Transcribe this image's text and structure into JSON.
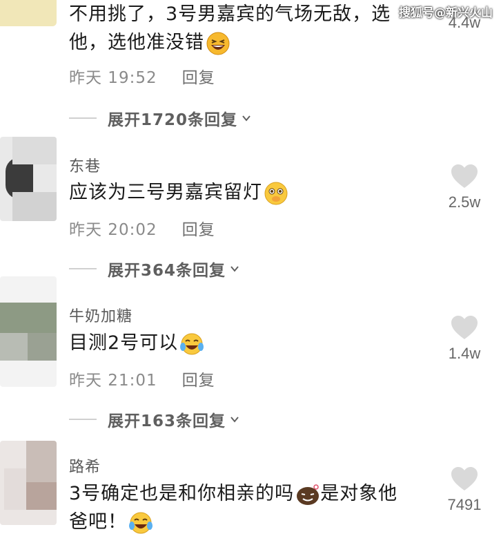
{
  "watermark": "搜狐号@新兴火山",
  "top_comment": {
    "line1": "不用挑了，3号男嘉宾的气场无敌，选",
    "line2": "他，选他准没错",
    "likes": "4.4w",
    "time": "昨天 19:52",
    "reply": "回复",
    "expand": "展开1720条回复"
  },
  "comments": [
    {
      "author": "东巷",
      "text": "应该为三号男嘉宾留灯",
      "likes": "2.5w",
      "time": "昨天 20:02",
      "reply": "回复",
      "expand": "展开364条回复"
    },
    {
      "author": "牛奶加糖",
      "text": "目测2号可以",
      "likes": "1.4w",
      "time": "昨天 21:01",
      "reply": "回复",
      "expand": "展开163条回复"
    },
    {
      "author": "路希",
      "text_line1_a": "3号确定也是和你相亲的吗",
      "text_line1_b": "是对象他",
      "text_line2": "爸吧！",
      "likes": "7491"
    }
  ],
  "colors": {
    "text": "#1a1a1a",
    "meta": "#8a8a8a",
    "author": "#5a5a5a",
    "heart": "#d9d9d9"
  }
}
